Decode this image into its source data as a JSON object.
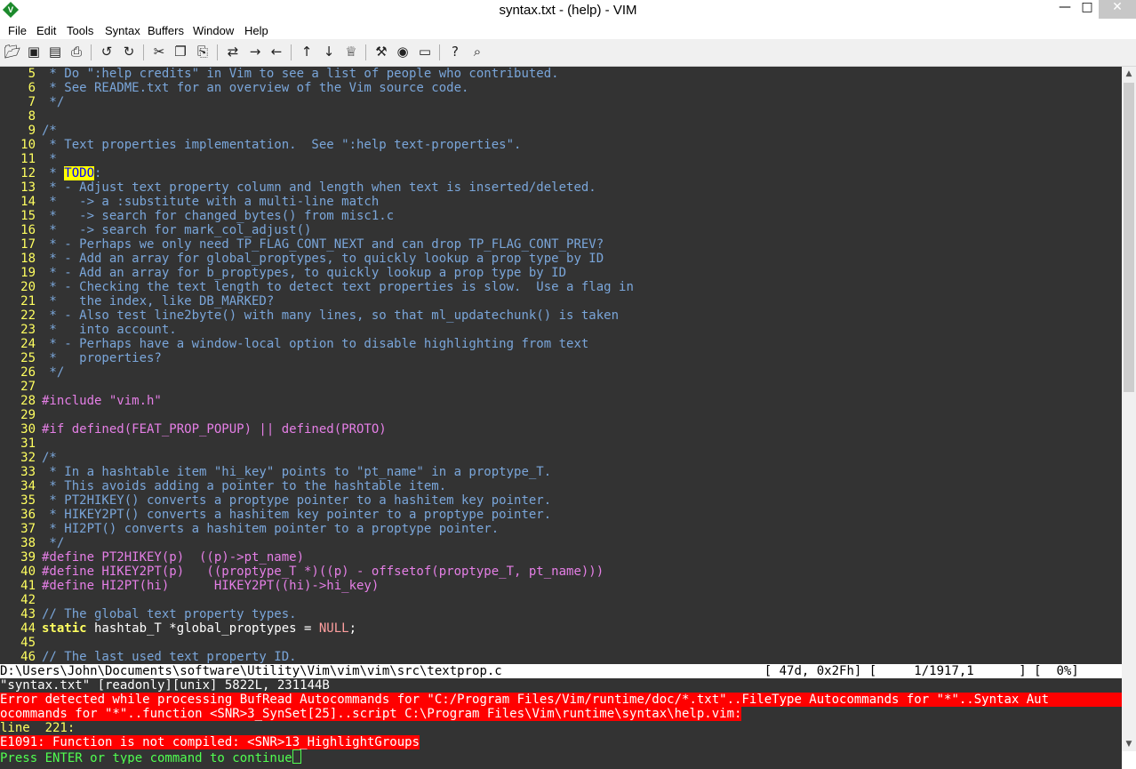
{
  "window": {
    "title": "syntax.txt - (help) - VIM",
    "app_icon": "vim-icon"
  },
  "menu": {
    "items": [
      "File",
      "Edit",
      "Tools",
      "Syntax",
      "Buffers",
      "Window",
      "Help"
    ]
  },
  "toolbar": {
    "buttons": [
      "open-icon",
      "save-icon",
      "save-all-icon",
      "print-icon",
      "undo-icon",
      "redo-icon",
      "cut-icon",
      "copy-icon",
      "paste-icon",
      "replace-icon",
      "find-next-icon",
      "find-prev-icon",
      "load-session-icon",
      "save-session-icon",
      "run-script-icon",
      "make-icon",
      "shell-icon",
      "tag-jump-icon",
      "help-icon",
      "find-help-icon"
    ]
  },
  "editor": {
    "lines": [
      {
        "n": "5",
        "segs": [
          [
            "c",
            " * Do \":help credits\" in Vim to see a list of people who contributed."
          ]
        ]
      },
      {
        "n": "6",
        "segs": [
          [
            "c",
            " * See README.txt for an overview of the Vim source code."
          ]
        ]
      },
      {
        "n": "7",
        "segs": [
          [
            "c",
            " */"
          ]
        ]
      },
      {
        "n": "8",
        "segs": []
      },
      {
        "n": "9",
        "segs": [
          [
            "c",
            "/*"
          ]
        ]
      },
      {
        "n": "10",
        "segs": [
          [
            "c",
            " * Text properties implementation.  See \":help text-properties\"."
          ]
        ]
      },
      {
        "n": "11",
        "segs": [
          [
            "c",
            " *"
          ]
        ]
      },
      {
        "n": "12",
        "segs": [
          [
            "c",
            " * "
          ],
          [
            "todo",
            "TODO"
          ],
          [
            "c",
            ":"
          ]
        ]
      },
      {
        "n": "13",
        "segs": [
          [
            "c",
            " * - Adjust text property column and length when text is inserted/deleted."
          ]
        ]
      },
      {
        "n": "14",
        "segs": [
          [
            "c",
            " *   -> a :substitute with a multi-line match"
          ]
        ]
      },
      {
        "n": "15",
        "segs": [
          [
            "c",
            " *   -> search for changed_bytes() from misc1.c"
          ]
        ]
      },
      {
        "n": "16",
        "segs": [
          [
            "c",
            " *   -> search for mark_col_adjust()"
          ]
        ]
      },
      {
        "n": "17",
        "segs": [
          [
            "c",
            " * - Perhaps we only need TP_FLAG_CONT_NEXT and can drop TP_FLAG_CONT_PREV?"
          ]
        ]
      },
      {
        "n": "18",
        "segs": [
          [
            "c",
            " * - Add an array for global_proptypes, to quickly lookup a prop type by ID"
          ]
        ]
      },
      {
        "n": "19",
        "segs": [
          [
            "c",
            " * - Add an array for b_proptypes, to quickly lookup a prop type by ID"
          ]
        ]
      },
      {
        "n": "20",
        "segs": [
          [
            "c",
            " * - Checking the text length to detect text properties is slow.  Use a flag in"
          ]
        ]
      },
      {
        "n": "21",
        "segs": [
          [
            "c",
            " *   the index, like DB_MARKED?"
          ]
        ]
      },
      {
        "n": "22",
        "segs": [
          [
            "c",
            " * - Also test line2byte() with many lines, so that ml_updatechunk() is taken"
          ]
        ]
      },
      {
        "n": "23",
        "segs": [
          [
            "c",
            " *   into account."
          ]
        ]
      },
      {
        "n": "24",
        "segs": [
          [
            "c",
            " * - Perhaps have a window-local option to disable highlighting from text"
          ]
        ]
      },
      {
        "n": "25",
        "segs": [
          [
            "c",
            " *   properties?"
          ]
        ]
      },
      {
        "n": "26",
        "segs": [
          [
            "c",
            " */"
          ]
        ]
      },
      {
        "n": "27",
        "segs": []
      },
      {
        "n": "28",
        "segs": [
          [
            "pp",
            "#include \"vim.h\""
          ]
        ]
      },
      {
        "n": "29",
        "segs": []
      },
      {
        "n": "30",
        "segs": [
          [
            "pp",
            "#if defined(FEAT_PROP_POPUP) || defined(PROTO)"
          ]
        ]
      },
      {
        "n": "31",
        "segs": []
      },
      {
        "n": "32",
        "segs": [
          [
            "c",
            "/*"
          ]
        ]
      },
      {
        "n": "33",
        "segs": [
          [
            "c",
            " * In a hashtable item \"hi_key\" points to \"pt_name\" in a proptype_T."
          ]
        ]
      },
      {
        "n": "34",
        "segs": [
          [
            "c",
            " * This avoids adding a pointer to the hashtable item."
          ]
        ]
      },
      {
        "n": "35",
        "segs": [
          [
            "c",
            " * PT2HIKEY() converts a proptype pointer to a hashitem key pointer."
          ]
        ]
      },
      {
        "n": "36",
        "segs": [
          [
            "c",
            " * HIKEY2PT() converts a hashitem key pointer to a proptype pointer."
          ]
        ]
      },
      {
        "n": "37",
        "segs": [
          [
            "c",
            " * HI2PT() converts a hashitem pointer to a proptype pointer."
          ]
        ]
      },
      {
        "n": "38",
        "segs": [
          [
            "c",
            " */"
          ]
        ]
      },
      {
        "n": "39",
        "segs": [
          [
            "pp",
            "#define PT2HIKEY(p)  ((p)->pt_name)"
          ]
        ]
      },
      {
        "n": "40",
        "segs": [
          [
            "pp",
            "#define HIKEY2PT(p)   ((proptype_T *)((p) - offsetof(proptype_T, pt_name)))"
          ]
        ]
      },
      {
        "n": "41",
        "segs": [
          [
            "pp",
            "#define HI2PT(hi)      HIKEY2PT((hi)->hi_key)"
          ]
        ]
      },
      {
        "n": "42",
        "segs": []
      },
      {
        "n": "43",
        "segs": [
          [
            "c",
            "// The global text property types."
          ]
        ]
      },
      {
        "n": "44",
        "segs": [
          [
            "kw",
            "static"
          ],
          [
            "txt",
            " hashtab_T *global_proptypes = "
          ],
          [
            "cst",
            "NULL"
          ],
          [
            "txt",
            ";"
          ]
        ]
      },
      {
        "n": "45",
        "segs": []
      },
      {
        "n": "46",
        "segs": [
          [
            "c",
            "// The last used text property ID."
          ]
        ]
      }
    ]
  },
  "statusline": {
    "text": "D:\\Users\\John\\Documents\\software\\Utility\\Vim\\vim\\vim\\src\\textprop.c                                   [ 47d, 0x2Fh] [     1/1917,1      ] [  0%]"
  },
  "messages": {
    "file_info": "\"syntax.txt\" [readonly][unix] 5822L, 231144B",
    "error1a": "Error detected while processing BufRead Autocommands for \"C:/Program Files/Vim/runtime/doc/*.txt\"..FileType Autocommands for \"*\"..Syntax Aut",
    "error1b": "ocommands for \"*\"..function <SNR>3_SynSet[25]..script C:\\Program Files\\Vim\\runtime\\syntax\\help.vim:",
    "line_info": "line  221:",
    "error2": "E1091: Function is not compiled: <SNR>13_HighlightGroups",
    "prompt": "Press ENTER or type command to continue"
  }
}
